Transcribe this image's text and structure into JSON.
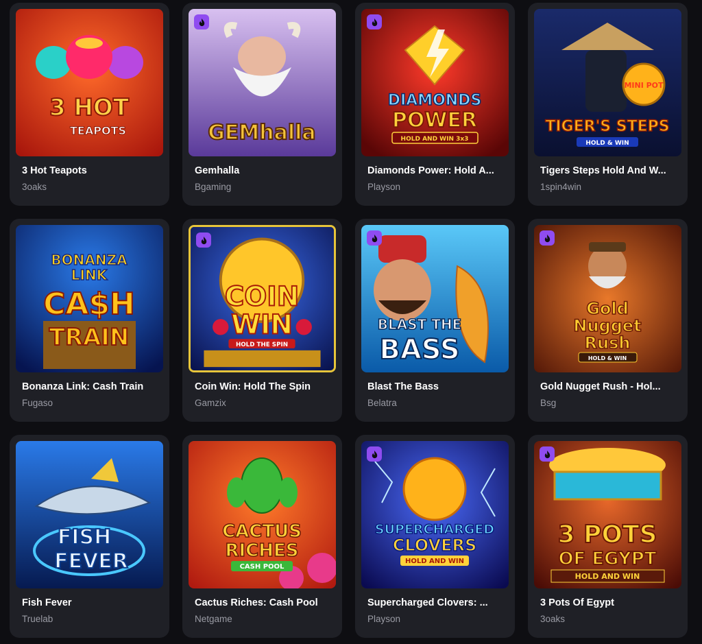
{
  "games": [
    {
      "title": "3 Hot Teapots",
      "provider": "3oaks",
      "hot": false,
      "art_lines": [
        "3 HOT",
        "TEAPOTS"
      ],
      "bg": [
        "#e8461c",
        "#b01c10"
      ],
      "fg": "#ffd34a"
    },
    {
      "title": "Gemhalla",
      "provider": "Bgaming",
      "hot": true,
      "art_lines": [
        "GEMhalla"
      ],
      "bg": [
        "#c9a8e8",
        "#6a4aa8"
      ],
      "fg": "#f3c23a"
    },
    {
      "title": "Diamonds Power: Hold A...",
      "provider": "Playson",
      "hot": true,
      "art_lines": [
        "DIAMONDS",
        "POWER",
        "HOLD AND WIN 3x3"
      ],
      "bg": [
        "#d01818",
        "#5a0606"
      ],
      "fg": "#ffd23c"
    },
    {
      "title": "Tigers Steps Hold And W...",
      "provider": "1spin4win",
      "hot": false,
      "art_lines": [
        "MINI POT",
        "TIGER'S STEPS",
        "HOLD & WIN"
      ],
      "bg": [
        "#2a4ab8",
        "#0a1240"
      ],
      "fg": "#ffb21a"
    },
    {
      "title": "Bonanza Link: Cash Train",
      "provider": "Fugaso",
      "hot": false,
      "art_lines": [
        "BONANZA",
        "LINK",
        "CA$H",
        "TRAIN"
      ],
      "bg": [
        "#1c5ad0",
        "#0a1a5a"
      ],
      "fg": "#ffc21c"
    },
    {
      "title": "Coin Win: Hold The Spin",
      "provider": "Gamzix",
      "hot": true,
      "selected": true,
      "art_lines": [
        "COIN",
        "WIN",
        "HOLD THE SPIN"
      ],
      "bg": [
        "#2a5ad8",
        "#0a1450"
      ],
      "fg": "#ffcc2a"
    },
    {
      "title": "Blast The Bass",
      "provider": "Belatra",
      "hot": true,
      "art_lines": [
        "BLAST THE",
        "BASS"
      ],
      "bg": [
        "#3aa8e8",
        "#0a4a90"
      ],
      "fg": "#ffffff"
    },
    {
      "title": "Gold Nugget Rush - Hol...",
      "provider": "Bsg",
      "hot": true,
      "art_lines": [
        "Gold",
        "Nugget",
        "Rush",
        "HOLD & WIN"
      ],
      "bg": [
        "#d85a1c",
        "#5a1a06"
      ],
      "fg": "#ffcc30"
    },
    {
      "title": "Fish Fever",
      "provider": "Truelab",
      "hot": false,
      "art_lines": [
        "FISH",
        "FEVER"
      ],
      "bg": [
        "#1a6ad8",
        "#061a50"
      ],
      "fg": "#eaf4ff"
    },
    {
      "title": "Cactus Riches: Cash Pool",
      "provider": "Netgame",
      "hot": false,
      "art_lines": [
        "CACTUS",
        "RICHES",
        "CASH POOL"
      ],
      "bg": [
        "#f05a1a",
        "#b01a10"
      ],
      "fg": "#ffd23a"
    },
    {
      "title": "Supercharged Clovers: ...",
      "provider": "Playson",
      "hot": true,
      "art_lines": [
        "SUPERCHARGED",
        "CLOVERS",
        "HOLD AND WIN"
      ],
      "bg": [
        "#2a3ac8",
        "#0a0a50"
      ],
      "fg": "#ffd23a"
    },
    {
      "title": "3 Pots Of Egypt",
      "provider": "3oaks",
      "hot": true,
      "art_lines": [
        "3 POTS",
        "OF EGYPT",
        "HOLD AND WIN"
      ],
      "bg": [
        "#d8551c",
        "#4a0c06"
      ],
      "fg": "#ffd23a"
    }
  ],
  "colors": {
    "page_bg": "#0e0e12",
    "card_bg": "#1f2026",
    "title": "#ffffff",
    "provider": "#9a9ba4",
    "hot_badge": "#8f4cf0",
    "selected_border": "#e7c53a"
  },
  "icons": {
    "hot_badge": "flame-icon"
  }
}
